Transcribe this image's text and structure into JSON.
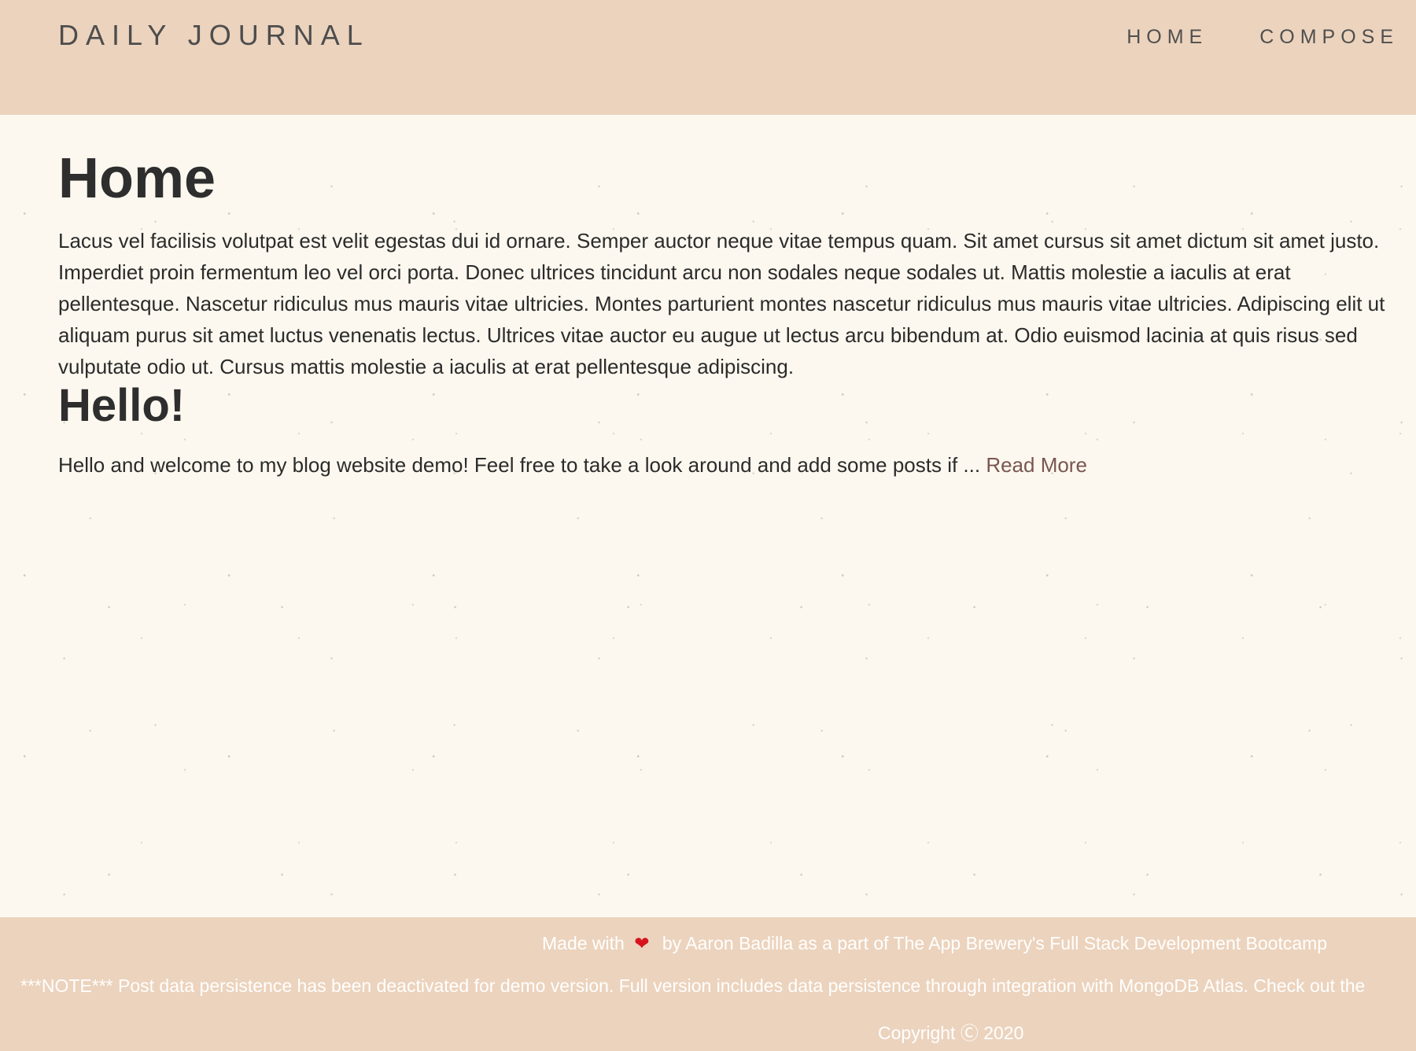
{
  "header": {
    "brand": "DAILY JOURNAL",
    "nav": [
      {
        "label": "HOME"
      },
      {
        "label": "COMPOSE"
      }
    ]
  },
  "main": {
    "title": "Home",
    "intro": "Lacus vel facilisis volutpat est velit egestas dui id ornare. Semper auctor neque vitae tempus quam. Sit amet cursus sit amet dictum sit amet justo. Imperdiet proin fermentum leo vel orci porta. Donec ultrices tincidunt arcu non sodales neque sodales ut. Mattis molestie a iaculis at erat pellentesque. Nascetur ridiculus mus mauris vitae ultricies. Montes parturient montes nascetur ridiculus mus mauris vitae ultricies. Adipiscing elit ut aliquam purus sit amet luctus venenatis lectus. Ultrices vitae auctor eu augue ut lectus arcu bibendum at. Odio euismod lacinia at quis risus sed vulputate odio ut. Cursus mattis molestie a iaculis at erat pellentesque adipiscing.",
    "posts": [
      {
        "title": "Hello!",
        "excerpt": "Hello and welcome to my blog website demo! Feel free to take a look around and add some posts if ... ",
        "read_more": "Read More"
      }
    ]
  },
  "footer": {
    "credit_prefix": "Made with",
    "heart_icon": "❤",
    "credit_suffix": "by Aaron Badilla as a part of The App Brewery's Full Stack Development Bootcamp",
    "note": "***NOTE*** Post data persistence has been deactivated for demo version. Full version includes data persistence through integration with MongoDB Atlas. Check out the",
    "copyright": "Copyright Ⓒ 2020"
  },
  "colors": {
    "header_footer_bg": "#ecd3bd",
    "page_bg": "#fcf8ef",
    "link": "#7a5650",
    "heart": "#d7141e"
  }
}
